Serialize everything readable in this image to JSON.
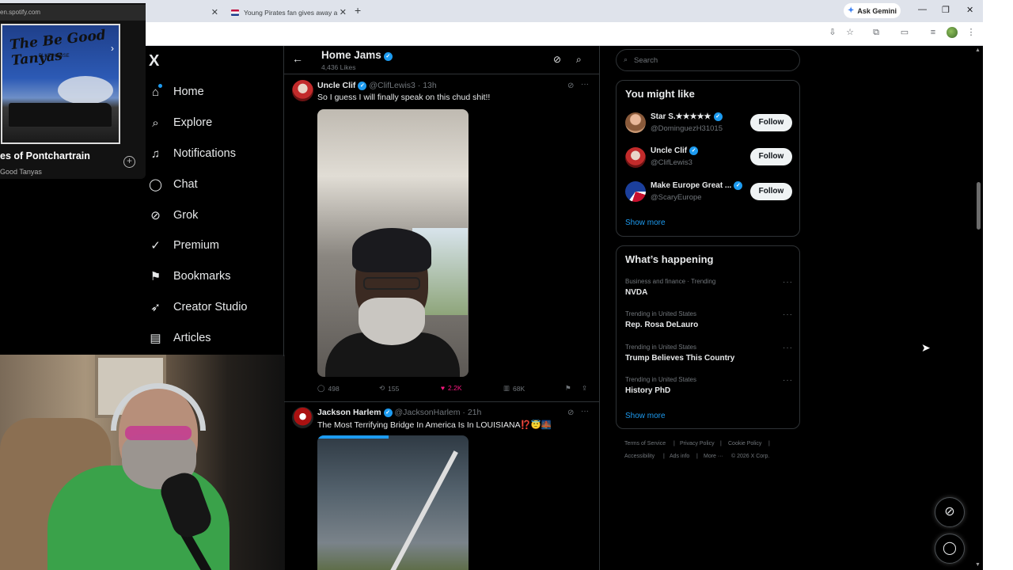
{
  "browser": {
    "tabs": [
      {
        "label": ""
      },
      {
        "label": "Young Pirates fan gives away a"
      }
    ],
    "new_tab": "+",
    "gemini_label": "Ask Gemini",
    "window_buttons": [
      "—",
      "❐",
      "✕"
    ]
  },
  "spotify": {
    "url": "en.spotify.com",
    "album_art_text": "The Be Good Tanyas",
    "album_art_sub": "BLUE HORSE",
    "song": "es of Pontchartrain",
    "artist": "Good Tanyas"
  },
  "nav": {
    "logo": "X",
    "items": [
      {
        "label": "Home",
        "icon": "home-icon"
      },
      {
        "label": "Explore",
        "icon": "search-icon"
      },
      {
        "label": "Notifications",
        "icon": "bell-icon"
      },
      {
        "label": "Chat",
        "icon": "chat-icon"
      },
      {
        "label": "Grok",
        "icon": "grok-icon"
      },
      {
        "label": "Premium",
        "icon": "premium-icon"
      },
      {
        "label": "Bookmarks",
        "icon": "bookmark-icon"
      },
      {
        "label": "Creator Studio",
        "icon": "rocket-icon"
      },
      {
        "label": "Articles",
        "icon": "article-icon"
      }
    ]
  },
  "header": {
    "title": "Home Jams",
    "likes": "4,436 Likes"
  },
  "posts": [
    {
      "name": "Uncle Clif",
      "handle": "@ClifLewis3",
      "time": "· 13h",
      "text": "So I guess I will finally speak on this chud shit!!",
      "replies": "498",
      "reposts": "155",
      "likes": "2.2K",
      "views": "68K"
    },
    {
      "name": "Jackson Harlem",
      "handle": "@JacksonHarlem",
      "time": "· 21h",
      "text": "The Most Terrifying Bridge In America Is In LOUISIANA⁉️😇🌉"
    }
  ],
  "search": {
    "placeholder": "Search"
  },
  "suggestions": {
    "title": "You might like",
    "items": [
      {
        "name": "Star S.★★★★★",
        "handle": "@DominguezH31015",
        "button": "Follow"
      },
      {
        "name": "Uncle Clif",
        "handle": "@ClifLewis3",
        "button": "Follow"
      },
      {
        "name": "Make Europe Great ...",
        "handle": "@ScaryEurope",
        "button": "Follow"
      }
    ],
    "show_more": "Show more"
  },
  "trending": {
    "title": "What’s happening",
    "items": [
      {
        "context": "Business and finance · Trending",
        "name": "NVDA"
      },
      {
        "context": "Trending in United States",
        "name": "Rep. Rosa DeLauro"
      },
      {
        "context": "Trending in United States",
        "name": "Trump Believes This Country"
      },
      {
        "context": "Trending in United States",
        "name": "History PhD"
      }
    ],
    "show_more": "Show more"
  },
  "footer": {
    "links": [
      "Terms of Service",
      "|",
      "Privacy Policy",
      "|",
      "Cookie Policy",
      "|",
      "Accessibility",
      "|",
      "Ads info",
      "|",
      "More ···",
      "© 2026 X Corp."
    ]
  },
  "colors": {
    "accent": "#1d9bf0",
    "like": "#f91880",
    "background": "#000000"
  }
}
